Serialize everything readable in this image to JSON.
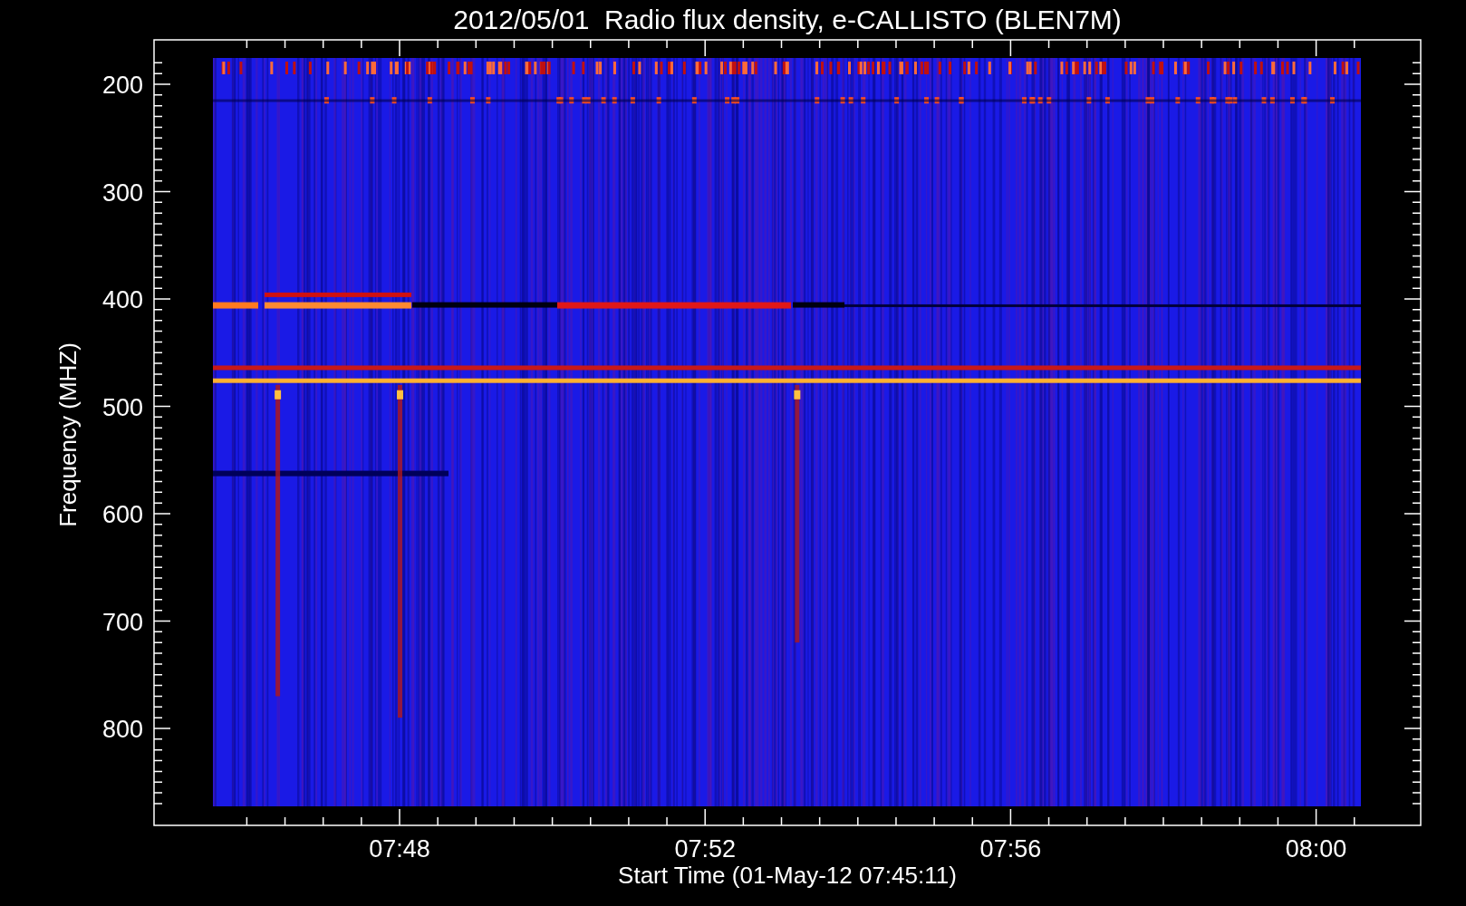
{
  "plot": {
    "title": "2012/05/01  Radio flux density, e-CALLISTO (BLEN7M)",
    "ylabel": "Frequency (MHZ)",
    "xlabel": "Start Time (01-May-12 07:45:11)",
    "yticks": [
      "200",
      "300",
      "400",
      "500",
      "600",
      "700",
      "800"
    ],
    "xticks": [
      "07:48",
      "07:52",
      "07:56",
      "08:00"
    ]
  }
}
